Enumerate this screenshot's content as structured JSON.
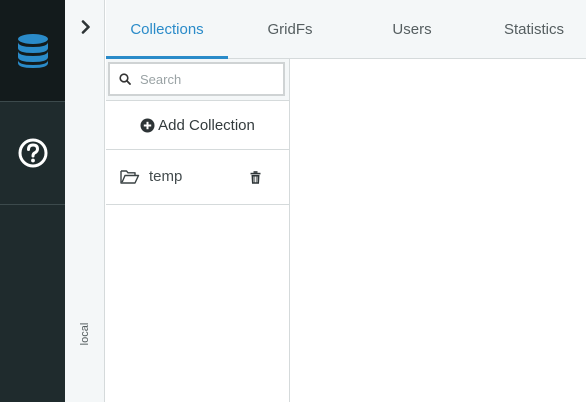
{
  "rail": {
    "db_icon": "database-icon",
    "help_icon": "question-circle-icon"
  },
  "strip": {
    "chevron_icon": "chevron-right-icon",
    "db_label": "local"
  },
  "tabs": [
    {
      "label": "Collections",
      "active": true
    },
    {
      "label": "GridFs",
      "active": false
    },
    {
      "label": "Users",
      "active": false
    },
    {
      "label": "Statistics",
      "active": false
    }
  ],
  "collections_panel": {
    "search_placeholder": "Search",
    "add_label": "Add Collection",
    "items": [
      {
        "name": "temp"
      }
    ]
  },
  "colors": {
    "accent": "#2a8bc9",
    "rail_dark": "#1f2b2d",
    "rail_darker": "#131b1c"
  }
}
